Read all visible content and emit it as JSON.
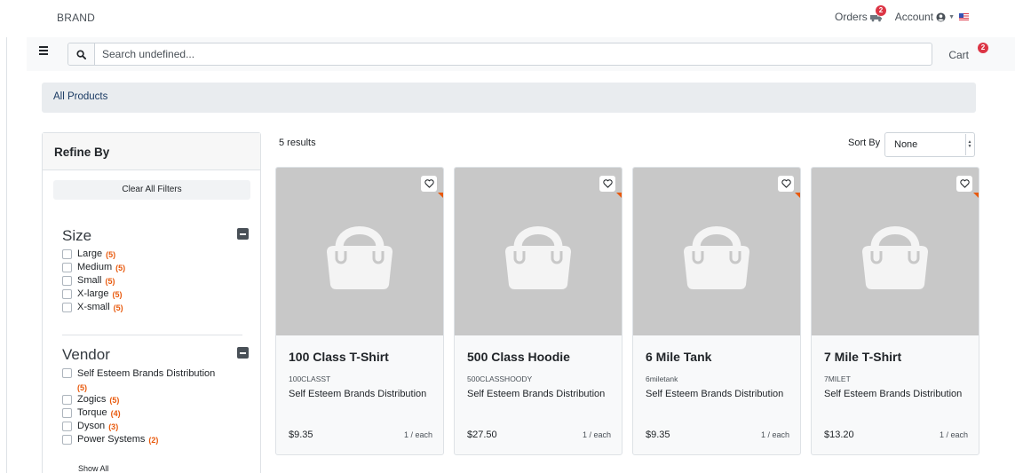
{
  "header": {
    "brand": "BRAND",
    "orders_label": "Orders",
    "orders_badge": "2",
    "account_label": "Account"
  },
  "search": {
    "placeholder": "Search undefined...",
    "cart_label": "Cart",
    "cart_badge": "2"
  },
  "breadcrumb": {
    "label": "All Products"
  },
  "sidebar": {
    "title": "Refine By",
    "clear_label": "Clear All Filters",
    "show_all_label": "Show All",
    "facets": [
      {
        "title": "Size",
        "items": [
          {
            "label": "Large",
            "count": "(5)"
          },
          {
            "label": "Medium",
            "count": "(5)"
          },
          {
            "label": "Small",
            "count": "(5)"
          },
          {
            "label": "X-large",
            "count": "(5)"
          },
          {
            "label": "X-small",
            "count": "(5)"
          }
        ]
      },
      {
        "title": "Vendor",
        "items": [
          {
            "label": "Self Esteem Brands Distribution",
            "count": "(5)"
          },
          {
            "label": "Zogics",
            "count": "(5)"
          },
          {
            "label": "Torque",
            "count": "(4)"
          },
          {
            "label": "Dyson",
            "count": "(3)"
          },
          {
            "label": "Power Systems",
            "count": "(2)"
          }
        ]
      }
    ]
  },
  "results": {
    "count_label": "5 results",
    "sort_label": "Sort By",
    "sort_value": "None"
  },
  "products": [
    {
      "name": "100 Class T-Shirt",
      "sku": "100CLASST",
      "vendor": "Self Esteem Brands Distribution",
      "price": "$9.35",
      "unit": "1 / each"
    },
    {
      "name": "500 Class Hoodie",
      "sku": "500CLASSHOODY",
      "vendor": "Self Esteem Brands Distribution",
      "price": "$27.50",
      "unit": "1 / each"
    },
    {
      "name": "6 Mile Tank",
      "sku": "6miletank",
      "vendor": "Self Esteem Brands Distribution",
      "price": "$9.35",
      "unit": "1 / each"
    },
    {
      "name": "7 Mile T-Shirt",
      "sku": "7MILET",
      "vendor": "Self Esteem Brands Distribution",
      "price": "$13.20",
      "unit": "1 / each"
    }
  ],
  "colors": {
    "badge": "#dc3545",
    "count": "#e8590c",
    "image_placeholder": "#c8c8c8",
    "breadcrumb_bg": "#e9ecef"
  },
  "icons": {
    "menu": "hamburger-icon",
    "search": "search-icon",
    "orders": "truck-icon",
    "account": "user-circle-icon",
    "flag": "us-flag-icon",
    "wishlist": "heart-icon",
    "product": "shopping-bag-icon",
    "collapse": "minus-square-icon"
  }
}
